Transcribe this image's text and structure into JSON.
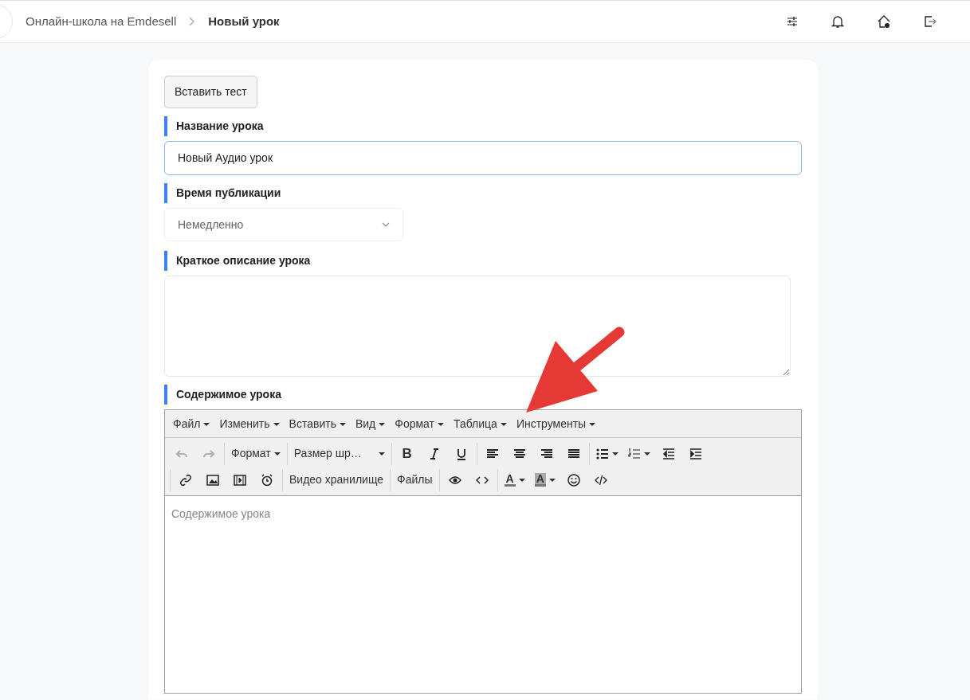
{
  "breadcrumb": {
    "parent": "Онлайн-школа на Emdesell",
    "current": "Новый урок"
  },
  "insert_test_button": "Вставить тест",
  "fields": [
    {
      "kind": "input",
      "label": "Название урока",
      "value": "Новый Аудио урок",
      "focused": true
    },
    {
      "kind": "select",
      "label": "Время публикации",
      "value": "Немедленно"
    },
    {
      "kind": "textarea",
      "label": "Краткое описание урока"
    }
  ],
  "editor": {
    "label": "Содержимое урока",
    "menu": [
      "Файл",
      "Изменить",
      "Вставить",
      "Вид",
      "Формат",
      "Таблица",
      "Инструменты"
    ],
    "undo_disabled": true,
    "redo_disabled": true,
    "bold_letter": "B",
    "format_dropdown": "Формат",
    "font_size_dropdown": "Размер шр…",
    "text_buttons": [
      "Видео хранилище",
      "Файлы"
    ],
    "text_color_letter": "A",
    "highlight_letter": "A",
    "placeholder": "Содержимое урока"
  }
}
